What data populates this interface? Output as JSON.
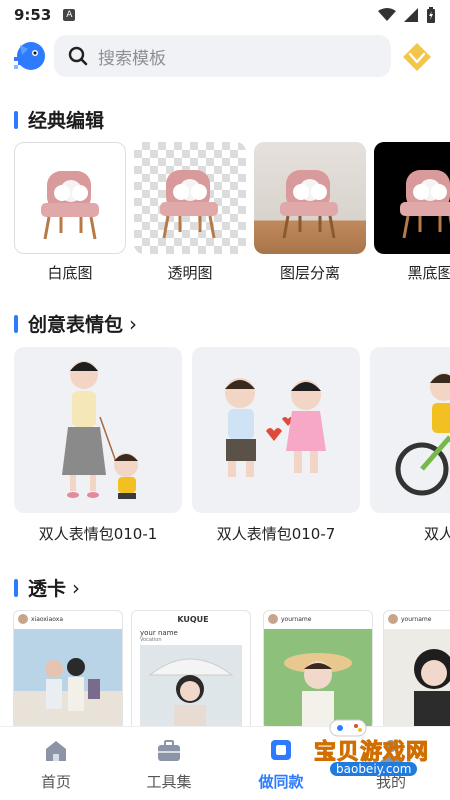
{
  "status": {
    "time": "9:53",
    "sim": "A"
  },
  "search": {
    "placeholder": "搜索模板"
  },
  "classic": {
    "title": "经典编辑",
    "items": [
      {
        "label": "白底图"
      },
      {
        "label": "透明图"
      },
      {
        "label": "图层分离"
      },
      {
        "label": "黑底图"
      }
    ]
  },
  "stickers": {
    "title": "创意表情包",
    "items": [
      {
        "label": "双人表情包010-1"
      },
      {
        "label": "双人表情包010-7"
      },
      {
        "label": "双人表情"
      }
    ]
  },
  "cards": {
    "title": "透卡",
    "items": [
      {
        "header": "xiaoxiaoxa"
      },
      {
        "header": "KUQUE",
        "name": "your name",
        "sub": "Vocation"
      },
      {
        "header": "yourname"
      },
      {
        "header": "yourname"
      }
    ]
  },
  "tabs": [
    {
      "label": "首页"
    },
    {
      "label": "工具集"
    },
    {
      "label": "做同款"
    },
    {
      "label": "我的"
    }
  ],
  "watermark": {
    "text": "宝贝游戏网",
    "url": "baobeiy.com"
  },
  "colors": {
    "accent": "#2f7bff",
    "vip": "#f3c548"
  }
}
